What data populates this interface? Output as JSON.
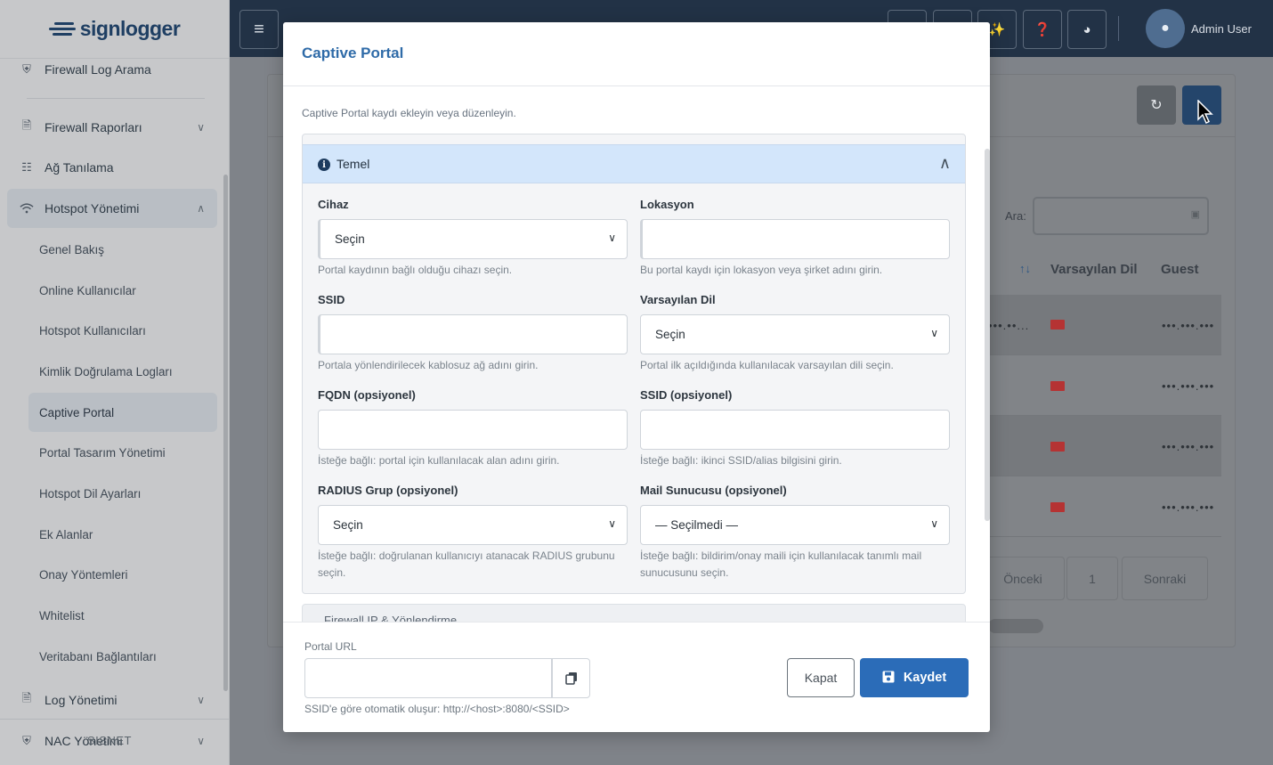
{
  "sidebar": {
    "logo": "signlogger",
    "items": [
      {
        "label": "Firewall Log Arama",
        "icon": "shield-icon"
      },
      {
        "label": "Firewall Raporları",
        "icon": "file-icon"
      },
      {
        "label": "Ağ Tanılama",
        "icon": "network-icon"
      },
      {
        "label": "Hotspot Yönetimi",
        "icon": "wifi-icon"
      },
      {
        "label": "Log Yönetimi",
        "icon": "file-icon"
      },
      {
        "label": "NAC Yönetimi",
        "icon": "shield-icon"
      }
    ],
    "subitems": [
      "Genel Bakış",
      "Online Kullanıcılar",
      "Hotspot Kullanıcıları",
      "Kimlik Doğrulama Logları",
      "Captive Portal",
      "Portal Tasarım Yönetimi",
      "Hotspot Dil Ayarları",
      "Ek Alanlar",
      "Onay Yöntemleri",
      "Whitelist",
      "Veritabanı Bağlantıları"
    ],
    "footer_ghost": "SISNET"
  },
  "topbar": {
    "user_name": "Admin User",
    "menu_icon": "≡"
  },
  "background": {
    "search_label": "Ara:",
    "columns": [
      "Varsayılan Dil",
      "Guest"
    ],
    "sort_icon": "↑↓",
    "row_masked": "•••.•••.•••",
    "row_masked_left": "•••.••...",
    "prev_label": "Önceki",
    "page_number": "1",
    "next_label": "Sonraki"
  },
  "modal": {
    "title": "Captive Portal",
    "subtitle": "Captive Portal kaydı ekleyin veya düzenleyin.",
    "section_title": "Temel",
    "section2_title": "Firewall IP & Yönlendirme",
    "fields": {
      "cihaz": {
        "label": "Cihaz",
        "value": "Seçin",
        "help": "Portal kaydının bağlı olduğu cihazı seçin."
      },
      "lokasyon": {
        "label": "Lokasyon",
        "value": "",
        "help": "Bu portal kaydı için lokasyon veya şirket adını girin."
      },
      "ssid": {
        "label": "SSID",
        "value": "",
        "help": "Portala yönlendirilecek kablosuz ağ adını girin."
      },
      "dil": {
        "label": "Varsayılan Dil",
        "value": "Seçin",
        "help": "Portal ilk açıldığında kullanılacak varsayılan dili seçin."
      },
      "fqdn": {
        "label": "FQDN (opsiyonel)",
        "value": "",
        "help": "İsteğe bağlı: portal için kullanılacak alan adını girin."
      },
      "ssid2": {
        "label": "SSID (opsiyonel)",
        "value": "",
        "help": "İsteğe bağlı: ikinci SSID/alias bilgisini girin."
      },
      "radius": {
        "label": "RADIUS Grup (opsiyonel)",
        "value": "Seçin",
        "help": "İsteğe bağlı: doğrulanan kullanıcıyı atanacak RADIUS grubunu seçin."
      },
      "mail": {
        "label": "Mail Sunucusu (opsiyonel)",
        "value": "— Seçilmedi —",
        "help": "İsteğe bağlı: bildirim/onay maili için kullanılacak tanımlı mail sunucusunu seçin."
      }
    },
    "portal_url": {
      "label": "Portal URL",
      "value": "",
      "help": "SSID'e göre otomatik oluşur: http://<host>:8080/<SSID>"
    },
    "close_label": "Kapat",
    "save_label": "Kaydet"
  }
}
